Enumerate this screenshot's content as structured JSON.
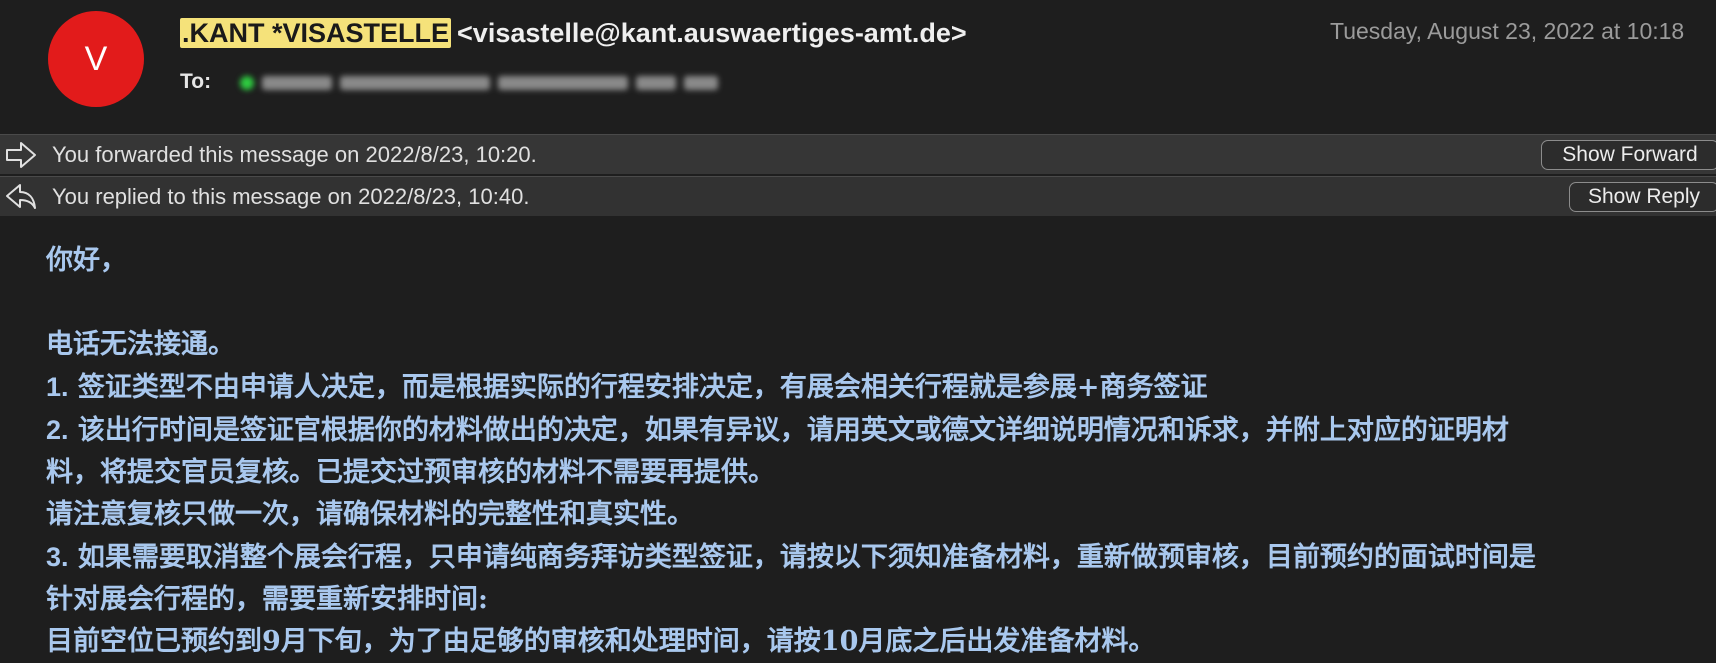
{
  "header": {
    "avatar_initial": "V",
    "sender_name": ".KANT *VISASTELLE",
    "sender_address": "<visastelle@kant.auswaertiges-amt.de>",
    "date": "Tuesday, August 23, 2022 at 10:18",
    "to_label": "To:"
  },
  "banners": {
    "forward": {
      "text": "You forwarded this message on 2022/8/23, 10:20.",
      "button": "Show Forward",
      "icon": "forward-arrow-icon"
    },
    "reply": {
      "text": "You replied to this message on 2022/8/23, 10:40.",
      "button": "Show Reply",
      "icon": "reply-arrow-icon"
    }
  },
  "body": {
    "greeting": "你好，",
    "line1": "电话无法接通。",
    "item1_num": "1.",
    "item1_text": " 签证类型不由申请人决定，而是根据实际的行程安排决定，有展会相关行程就是参展+商务签证",
    "item2_num": "2.",
    "item2_text_a": " 该出行时间是签证官根据你的材料做出的决定，如果有异议，请用英文或德文详细说明情况和诉求，并附上对应的证明材",
    "item2_text_b": "料，将提交官员复核。已提交过预审核的材料不需要再提供。",
    "note": "请注意复核只做一次，请确保材料的完整性和真实性。",
    "item3_num": "3.",
    "item3_text_a": " 如果需要取消整个展会行程，只申请纯商务拜访类型签证，请按以下须知准备材料，重新做预审核，目前预约的面试时间是",
    "item3_text_b": "针对展会行程的，需要重新安排时间:",
    "last": "目前空位已预约到9月下旬，为了由足够的审核和处理时间，请按10月底之后出发准备材料。"
  },
  "colors": {
    "background": "#1e1e1e",
    "avatar": "#e21b1b",
    "highlight": "#f5e27a",
    "body_text": "#a9c8ee"
  }
}
